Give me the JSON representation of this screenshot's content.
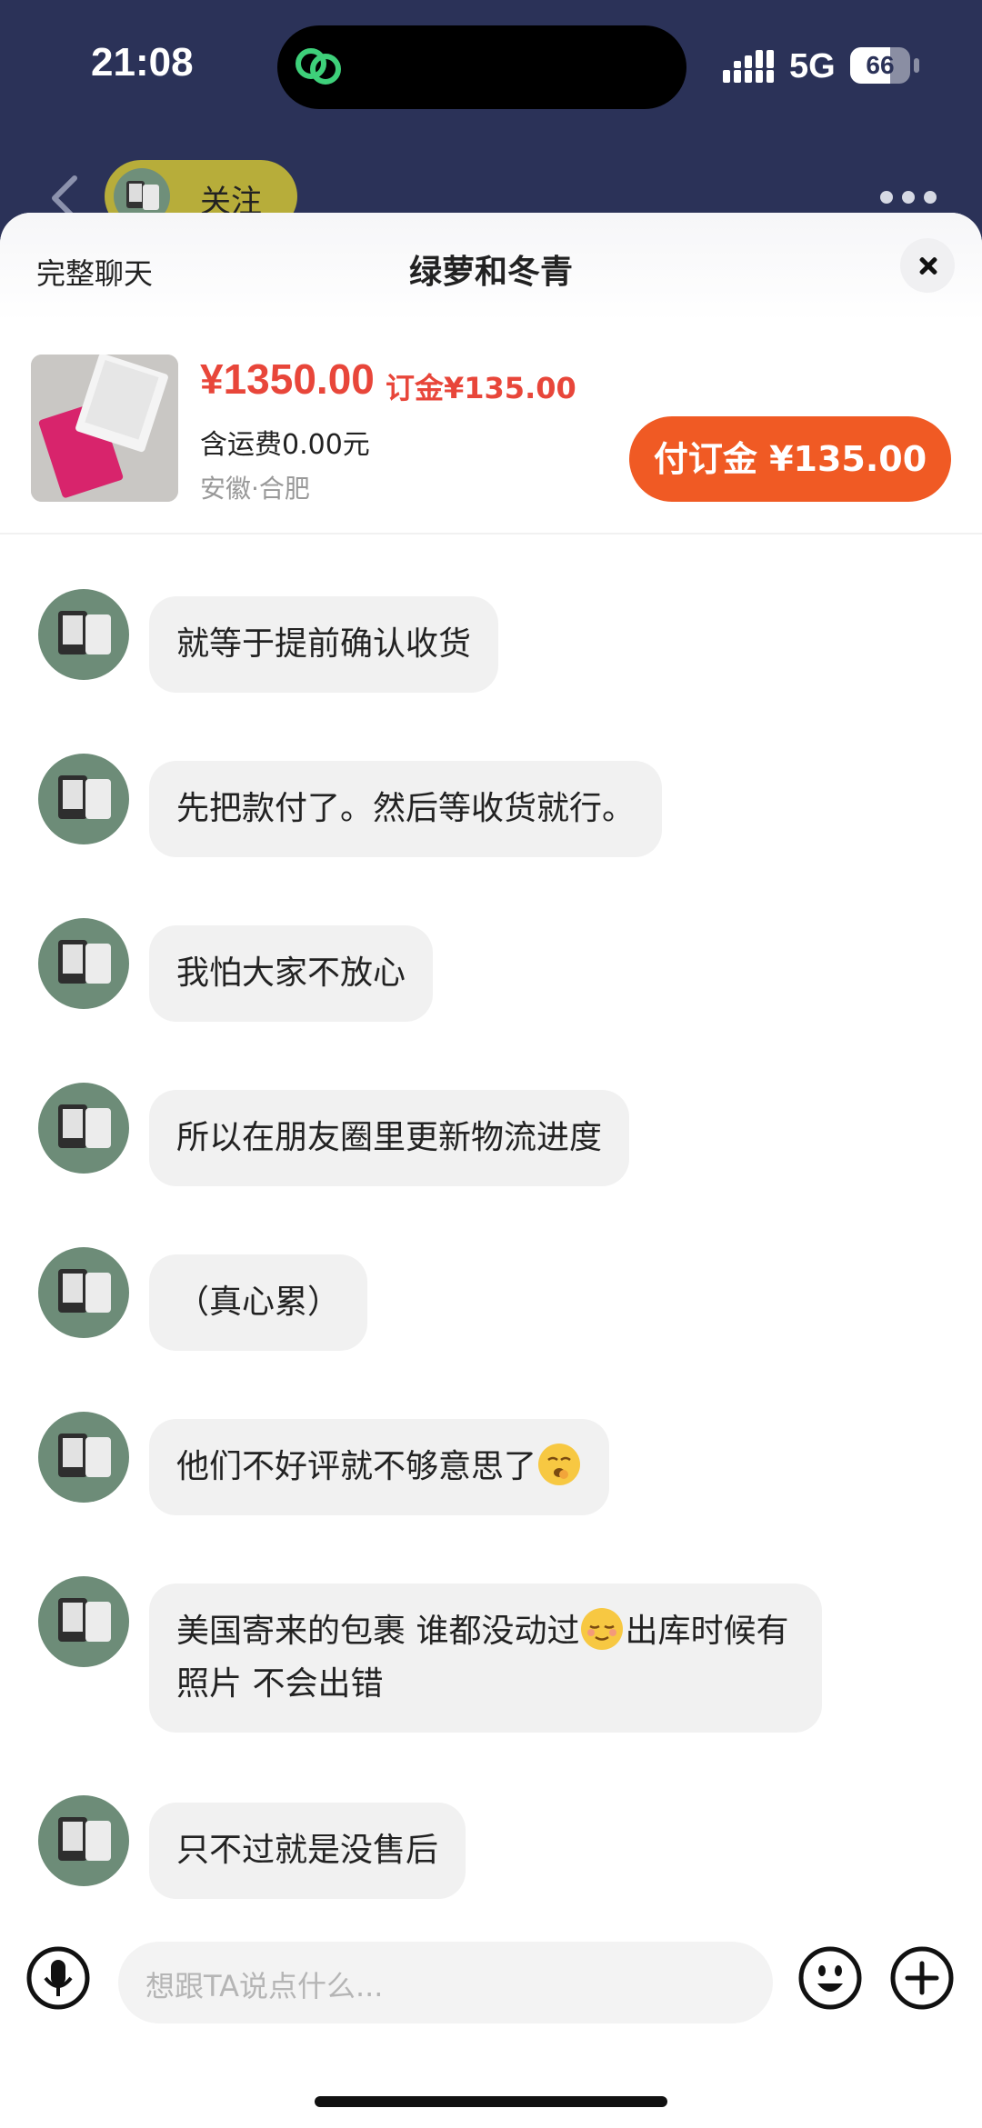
{
  "status_bar": {
    "time": "21:08",
    "network": "5G",
    "battery": "66",
    "battery_level": 0.66
  },
  "header": {
    "follow_label": "关注"
  },
  "sheet": {
    "full_chat_label": "完整聊天",
    "title": "绿萝和冬青"
  },
  "product": {
    "price": "¥1350.00",
    "deposit": "订金¥135.00",
    "shipping": "含运费0.00元",
    "location": "安徽·合肥",
    "pay_button": "付订金 ¥135.00"
  },
  "messages": [
    {
      "text": "就等于提前确认收货"
    },
    {
      "text": "先把款付了。然后等收货就行。"
    },
    {
      "text": "我怕大家不放心"
    },
    {
      "text": "所以在朋友圈里更新物流进度"
    },
    {
      "text": "（真心累）"
    },
    {
      "text": "他们不好评就不够意思了",
      "emoji": "yawning-face-icon"
    },
    {
      "text_a": "美国寄来的包裹 谁都没动过",
      "emoji": "relieved-face-icon",
      "text_b": "出库时候有照片 不会出错"
    },
    {
      "text": "只不过就是没售后"
    }
  ],
  "input": {
    "placeholder": "想跟TA说点什么..."
  },
  "colors": {
    "accent": "#f05a24",
    "price": "#e8463a",
    "header_bg": "#2b3258",
    "bubble_bg": "#f1f1f1"
  }
}
